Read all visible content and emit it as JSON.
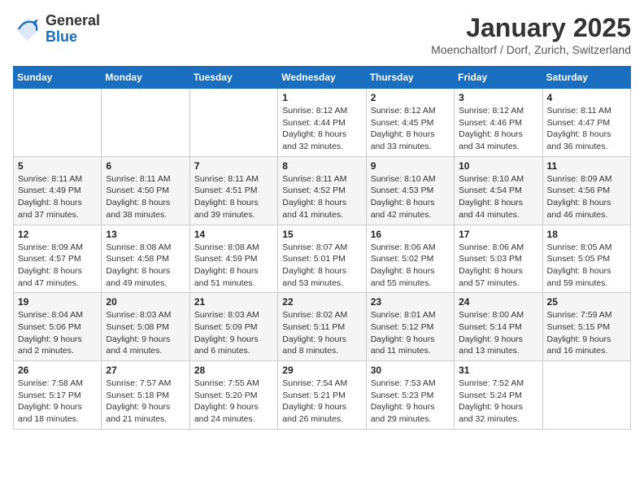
{
  "logo": {
    "general": "General",
    "blue": "Blue"
  },
  "title": "January 2025",
  "subtitle": "Moenchaltorf / Dorf, Zurich, Switzerland",
  "days_header": [
    "Sunday",
    "Monday",
    "Tuesday",
    "Wednesday",
    "Thursday",
    "Friday",
    "Saturday"
  ],
  "weeks": [
    [
      {
        "day": "",
        "info": ""
      },
      {
        "day": "",
        "info": ""
      },
      {
        "day": "",
        "info": ""
      },
      {
        "day": "1",
        "info": "Sunrise: 8:12 AM\nSunset: 4:44 PM\nDaylight: 8 hours and 32 minutes."
      },
      {
        "day": "2",
        "info": "Sunrise: 8:12 AM\nSunset: 4:45 PM\nDaylight: 8 hours and 33 minutes."
      },
      {
        "day": "3",
        "info": "Sunrise: 8:12 AM\nSunset: 4:46 PM\nDaylight: 8 hours and 34 minutes."
      },
      {
        "day": "4",
        "info": "Sunrise: 8:11 AM\nSunset: 4:47 PM\nDaylight: 8 hours and 36 minutes."
      }
    ],
    [
      {
        "day": "5",
        "info": "Sunrise: 8:11 AM\nSunset: 4:49 PM\nDaylight: 8 hours and 37 minutes."
      },
      {
        "day": "6",
        "info": "Sunrise: 8:11 AM\nSunset: 4:50 PM\nDaylight: 8 hours and 38 minutes."
      },
      {
        "day": "7",
        "info": "Sunrise: 8:11 AM\nSunset: 4:51 PM\nDaylight: 8 hours and 39 minutes."
      },
      {
        "day": "8",
        "info": "Sunrise: 8:11 AM\nSunset: 4:52 PM\nDaylight: 8 hours and 41 minutes."
      },
      {
        "day": "9",
        "info": "Sunrise: 8:10 AM\nSunset: 4:53 PM\nDaylight: 8 hours and 42 minutes."
      },
      {
        "day": "10",
        "info": "Sunrise: 8:10 AM\nSunset: 4:54 PM\nDaylight: 8 hours and 44 minutes."
      },
      {
        "day": "11",
        "info": "Sunrise: 8:09 AM\nSunset: 4:56 PM\nDaylight: 8 hours and 46 minutes."
      }
    ],
    [
      {
        "day": "12",
        "info": "Sunrise: 8:09 AM\nSunset: 4:57 PM\nDaylight: 8 hours and 47 minutes."
      },
      {
        "day": "13",
        "info": "Sunrise: 8:08 AM\nSunset: 4:58 PM\nDaylight: 8 hours and 49 minutes."
      },
      {
        "day": "14",
        "info": "Sunrise: 8:08 AM\nSunset: 4:59 PM\nDaylight: 8 hours and 51 minutes."
      },
      {
        "day": "15",
        "info": "Sunrise: 8:07 AM\nSunset: 5:01 PM\nDaylight: 8 hours and 53 minutes."
      },
      {
        "day": "16",
        "info": "Sunrise: 8:06 AM\nSunset: 5:02 PM\nDaylight: 8 hours and 55 minutes."
      },
      {
        "day": "17",
        "info": "Sunrise: 8:06 AM\nSunset: 5:03 PM\nDaylight: 8 hours and 57 minutes."
      },
      {
        "day": "18",
        "info": "Sunrise: 8:05 AM\nSunset: 5:05 PM\nDaylight: 8 hours and 59 minutes."
      }
    ],
    [
      {
        "day": "19",
        "info": "Sunrise: 8:04 AM\nSunset: 5:06 PM\nDaylight: 9 hours and 2 minutes."
      },
      {
        "day": "20",
        "info": "Sunrise: 8:03 AM\nSunset: 5:08 PM\nDaylight: 9 hours and 4 minutes."
      },
      {
        "day": "21",
        "info": "Sunrise: 8:03 AM\nSunset: 5:09 PM\nDaylight: 9 hours and 6 minutes."
      },
      {
        "day": "22",
        "info": "Sunrise: 8:02 AM\nSunset: 5:11 PM\nDaylight: 9 hours and 8 minutes."
      },
      {
        "day": "23",
        "info": "Sunrise: 8:01 AM\nSunset: 5:12 PM\nDaylight: 9 hours and 11 minutes."
      },
      {
        "day": "24",
        "info": "Sunrise: 8:00 AM\nSunset: 5:14 PM\nDaylight: 9 hours and 13 minutes."
      },
      {
        "day": "25",
        "info": "Sunrise: 7:59 AM\nSunset: 5:15 PM\nDaylight: 9 hours and 16 minutes."
      }
    ],
    [
      {
        "day": "26",
        "info": "Sunrise: 7:58 AM\nSunset: 5:17 PM\nDaylight: 9 hours and 18 minutes."
      },
      {
        "day": "27",
        "info": "Sunrise: 7:57 AM\nSunset: 5:18 PM\nDaylight: 9 hours and 21 minutes."
      },
      {
        "day": "28",
        "info": "Sunrise: 7:55 AM\nSunset: 5:20 PM\nDaylight: 9 hours and 24 minutes."
      },
      {
        "day": "29",
        "info": "Sunrise: 7:54 AM\nSunset: 5:21 PM\nDaylight: 9 hours and 26 minutes."
      },
      {
        "day": "30",
        "info": "Sunrise: 7:53 AM\nSunset: 5:23 PM\nDaylight: 9 hours and 29 minutes."
      },
      {
        "day": "31",
        "info": "Sunrise: 7:52 AM\nSunset: 5:24 PM\nDaylight: 9 hours and 32 minutes."
      },
      {
        "day": "",
        "info": ""
      }
    ]
  ]
}
